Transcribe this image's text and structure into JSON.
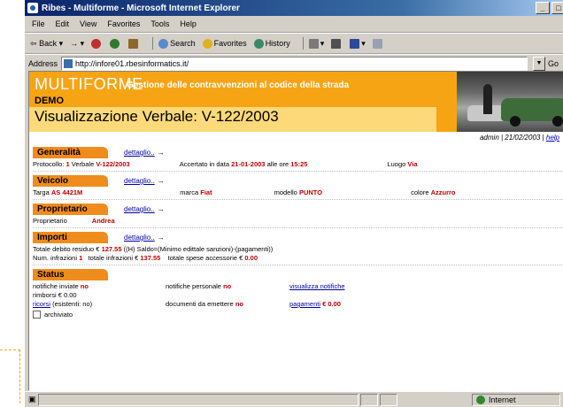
{
  "window": {
    "title": "Ribes - Multiforme - Microsoft Internet Explorer"
  },
  "titlebar_buttons": {
    "min": "_",
    "max": "□",
    "close": "×"
  },
  "menu": [
    "File",
    "Edit",
    "View",
    "Favorites",
    "Tools",
    "Help"
  ],
  "toolbar": {
    "back": "Back",
    "search": "Search",
    "favorites": "Favorites",
    "history": "History"
  },
  "address": {
    "label": "Address",
    "url": "http://infore01.rbesinformatics.it/",
    "go": "Go"
  },
  "banner": {
    "brand": "MULTIFORME",
    "subtitle": "Gestione delle contravvenzioni al codice della strada",
    "demo": "DEMO",
    "heading": "Visualizzazione Verbale: V-122/2003"
  },
  "user": {
    "text": "admin | 21/02/2003 |",
    "link": "help"
  },
  "sections": {
    "generalita": {
      "title": "Generalità",
      "link": "dettaglio..",
      "arrow": "→",
      "protocollo_label": "Protocollo:",
      "protocollo": "1",
      "verbale_label": "Verbale",
      "verbale": "V-122/2003",
      "accertato_label": "Accertato in data",
      "data": "21-01-2003",
      "ore_label": "alle ore",
      "ore": "15:25",
      "luogo_label": "Luogo",
      "luogo": "Via"
    },
    "veicolo": {
      "title": "Veicolo",
      "link": "dettaglio..",
      "arrow": "→",
      "targa_label": "Targa",
      "targa": "AS 4421M",
      "marca_label": "marca",
      "marca": "Fiat",
      "modello_label": "modello",
      "modello": "PUNTO",
      "colore_label": "colore",
      "colore": "Azzurro"
    },
    "proprietario": {
      "title": "Proprietario",
      "link": "dettaglio..",
      "arrow": "→",
      "label": "Proprietario",
      "value": "Andrea"
    },
    "importi": {
      "title": "Importi",
      "link": "dettaglio..",
      "arrow": "→",
      "line1_label": "Totale debito residuo €",
      "line1_value": "127.55",
      "line1_rest": "((H) Saldo=(Minimo edittale sanzioni)-(pagamenti))",
      "line2_label": "Num. infrazioni",
      "line2_value": "1",
      "line2_mid": "totale infrazioni €",
      "line2_mid_value": "137.55",
      "line2_end": "totale spese accessorie €",
      "line2_end_value": "0.00"
    },
    "status": {
      "title": "Status",
      "notifiche_label": "notifiche inviate",
      "notifiche_value": "no",
      "notifiche_pers_label": "notifiche personale",
      "notifiche_pers_value": "no",
      "visualizza_link": "visualizza notifiche",
      "rimborsi": "rimborsi € 0.00",
      "ricorsi_link": "ricorsi",
      "ricorsi_rest": "(esistenti: no)",
      "documenti_label": "documenti da emettere",
      "documenti_value": "no",
      "pagamenti_link": "pagamenti",
      "pagamenti_value": "€ 0.00",
      "archiviato": "archiviato"
    }
  },
  "statusbar": {
    "zone": "Internet"
  }
}
